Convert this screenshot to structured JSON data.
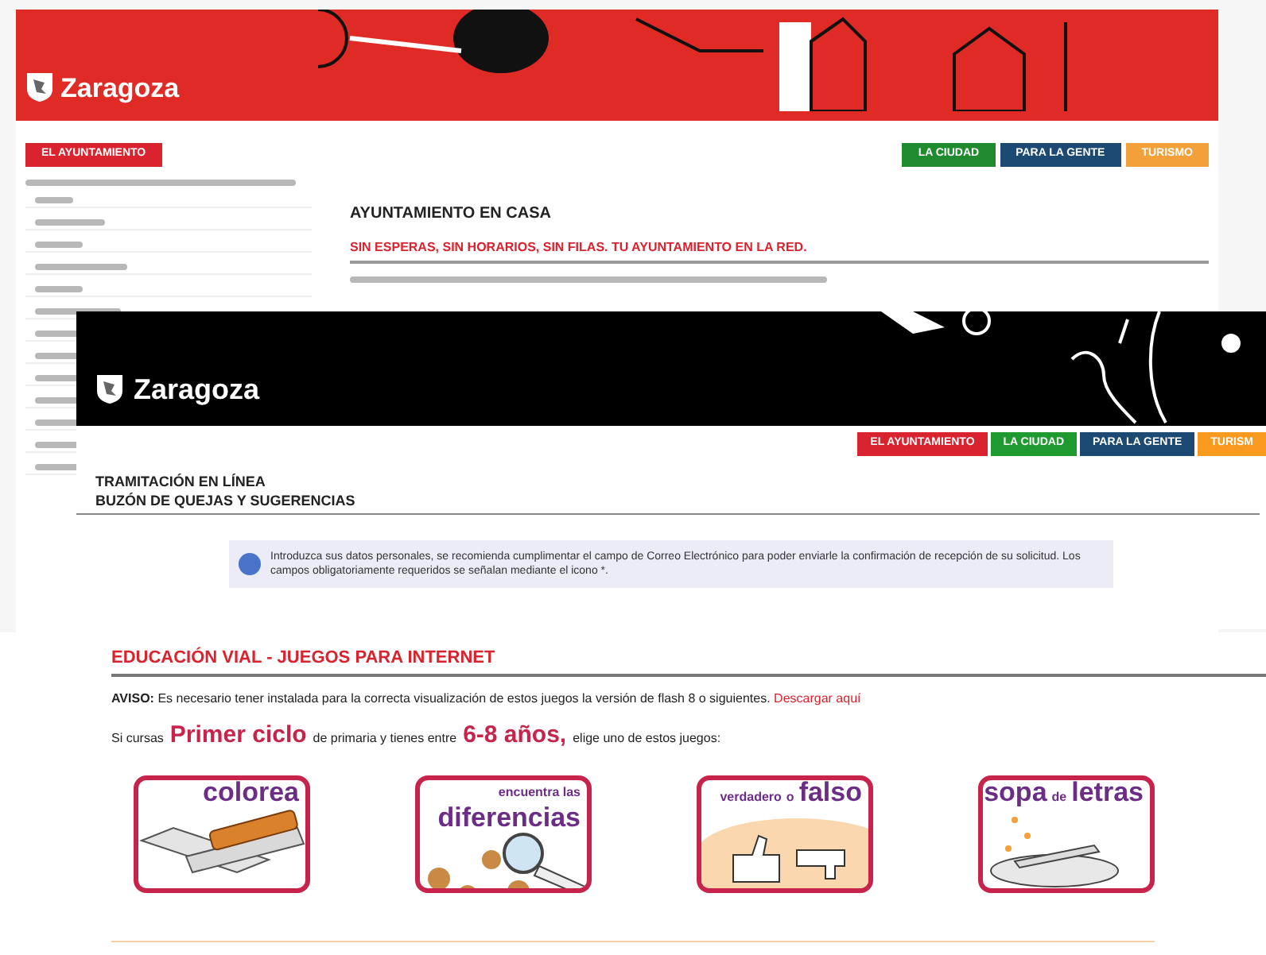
{
  "back_page": {
    "logo": "Zaragoza",
    "nav_left": "EL AYUNTAMIENTO",
    "nav_right": [
      {
        "label": "LA CIUDAD",
        "color": "#1f8a2e"
      },
      {
        "label": "PARA LA GENTE",
        "color": "#1d4a73"
      },
      {
        "label": "TURISMO",
        "color": "#f4a03a"
      }
    ],
    "title": "AYUNTAMIENTO EN CASA",
    "subtitle": "SIN ESPERAS, SIN HORARIOS, SIN FILAS. TU AYUNTAMIENTO EN LA RED."
  },
  "front_page": {
    "logo": "Zaragoza",
    "nav": [
      {
        "label": "EL AYUNTAMIENTO",
        "color": "#d9232e"
      },
      {
        "label": "LA CIUDAD",
        "color": "#1f9a2e"
      },
      {
        "label": "PARA LA GENTE",
        "color": "#1d4a73"
      },
      {
        "label": "TURISM",
        "color": "#f79a1e"
      }
    ],
    "titles": [
      "TRAMITACIÓN EN LÍNEA",
      "BUZÓN DE QUEJAS Y SUGERENCIAS"
    ],
    "notice": "Introduzca sus datos personales, se recomienda cumplimentar el campo de Correo Electrónico para poder enviarle la confirmación de recepción de su solicitud. Los campos obligatoriamente requeridos se señalan mediante el icono *."
  },
  "games_page": {
    "heading": "EDUCACIÓN VIAL - JUEGOS PARA INTERNET",
    "notice": "**AVISO:** Es necesario tener instalada para la correcta visualización de estos juegos la versión de flash 8 o siguientes.",
    "notice_link": "Descargar aquí",
    "intro": [
      {
        "text": "Si cursas",
        "emphasis": false
      },
      {
        "text": "Primer ciclo",
        "emphasis": true
      },
      {
        "text": "de primaria y tienes entre",
        "emphasis": false
      },
      {
        "text": "6-8 años,",
        "emphasis": true
      },
      {
        "text": "elige uno de estos juegos:",
        "emphasis": false
      }
    ],
    "games": [
      {
        "kind": "crayon",
        "parts": [
          {
            "text": "colorea",
            "emphasis": true
          }
        ]
      },
      {
        "kind": "magnifier",
        "parts": [
          {
            "text": "encuentra las",
            "emphasis": false
          },
          {
            "text": "diferencias",
            "emphasis": true
          }
        ]
      },
      {
        "kind": "thumbs",
        "parts": [
          {
            "text": "verdadero",
            "emphasis": false
          },
          {
            "text": "o",
            "emphasis": false
          },
          {
            "text": "falso",
            "emphasis": true
          }
        ]
      },
      {
        "kind": "letters",
        "parts": [
          {
            "text": "sopa",
            "emphasis": true
          },
          {
            "text": "de",
            "emphasis": false
          },
          {
            "text": "letras",
            "emphasis": true
          }
        ]
      }
    ]
  }
}
